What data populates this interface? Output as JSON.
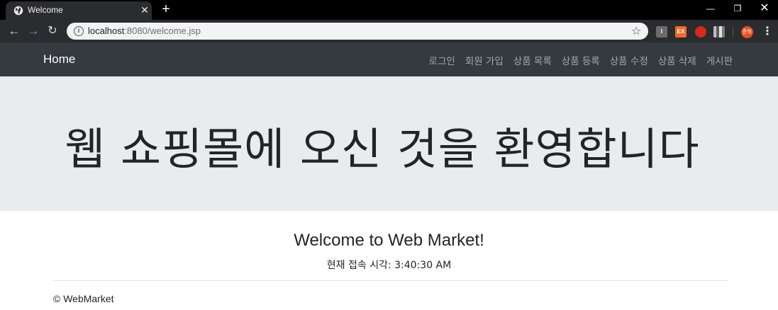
{
  "browser": {
    "tab_title": "Welcome",
    "url_host": "localhost",
    "url_rest": ":8080/welcome.jsp",
    "extensions": [
      {
        "name": "ext-i",
        "label": "I"
      },
      {
        "name": "ext-ex",
        "label": "EX"
      },
      {
        "name": "ext-hand",
        "label": ""
      },
      {
        "name": "ext-barcode",
        "label": ""
      }
    ],
    "profile_label": "준혁"
  },
  "navbar": {
    "brand": "Home",
    "links": [
      "로그인",
      "회원 가입",
      "상품 목록",
      "상품 등록",
      "상품 수정",
      "상품 삭제",
      "게시판"
    ]
  },
  "jumbotron": {
    "title": "웹 쇼핑몰에 오신 것을 환영합니다"
  },
  "main": {
    "welcome": "Welcome to Web Market!",
    "access_time": "현재 접속 시각: 3:40:30 AM"
  },
  "footer": {
    "copyright": "© WebMarket"
  },
  "colors": {
    "navbar_bg": "#343a40",
    "jumbotron_bg": "#e9ecef",
    "browser_bg": "#2b2c2f"
  }
}
